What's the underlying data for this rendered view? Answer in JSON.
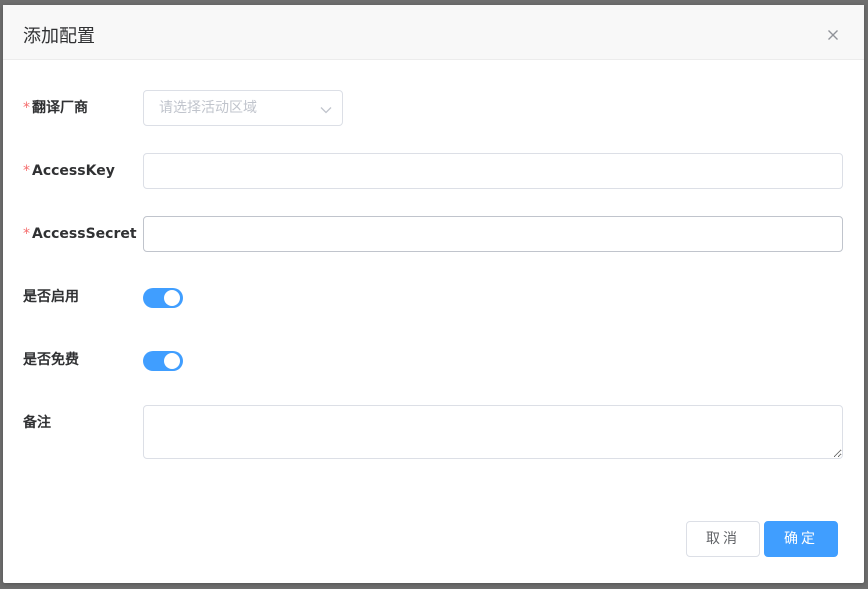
{
  "dialog": {
    "title": "添加配置",
    "close_icon": "close-icon"
  },
  "form": {
    "vendor": {
      "required_mark": "*",
      "label": "翻译厂商",
      "placeholder": "请选择活动区域",
      "arrow_icon": "chevron-down-icon"
    },
    "access_key": {
      "required_mark": "*",
      "label": "AccessKey",
      "value": ""
    },
    "access_secret": {
      "required_mark": "*",
      "label": "AccessSecret",
      "value": ""
    },
    "enabled": {
      "label": "是否启用",
      "on": true
    },
    "free": {
      "label": "是否免费",
      "on": true
    },
    "remark": {
      "label": "备注",
      "value": ""
    }
  },
  "footer": {
    "cancel_label": "取消",
    "confirm_label": "确定"
  },
  "colors": {
    "primary": "#409eff",
    "required": "#f56c6c",
    "border": "#dcdfe6",
    "placeholder": "#c0c4cc"
  }
}
